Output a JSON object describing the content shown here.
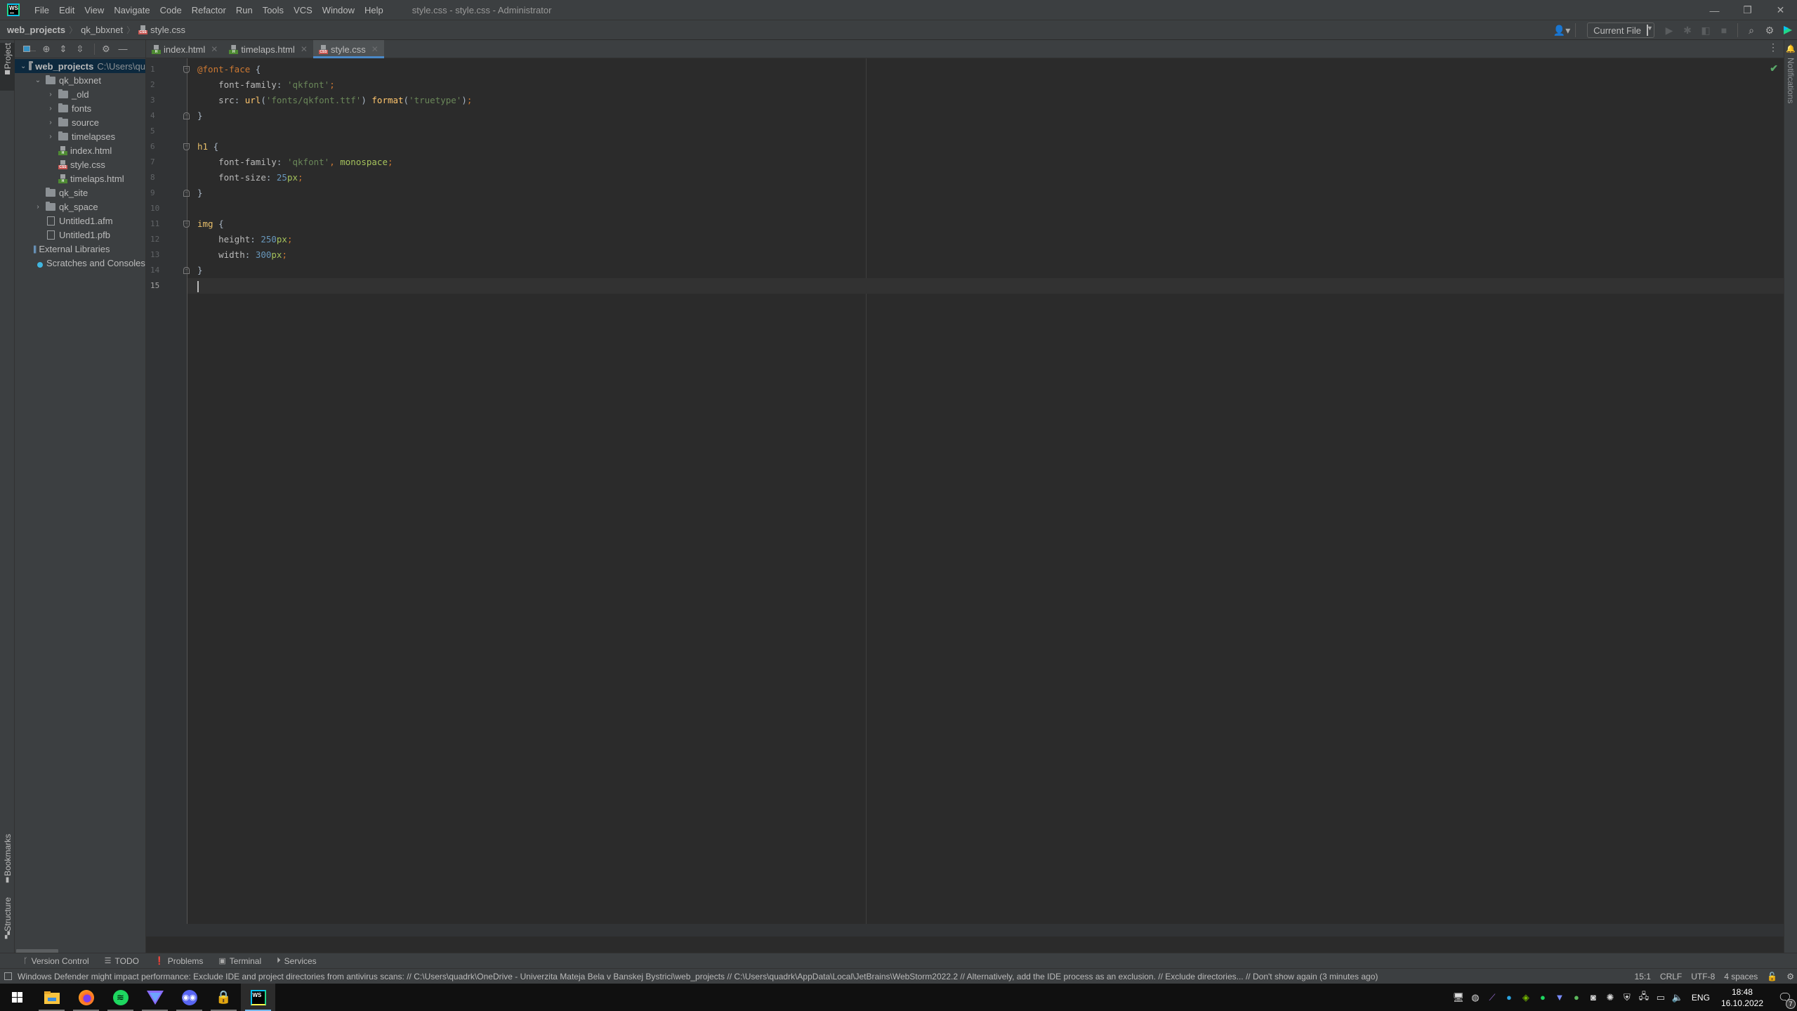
{
  "titlebar": {
    "app_logo": "WS",
    "menu": [
      "File",
      "Edit",
      "View",
      "Navigate",
      "Code",
      "Refactor",
      "Run",
      "Tools",
      "VCS",
      "Window",
      "Help"
    ],
    "window_title": "style.css - style.css - Administrator",
    "controls": {
      "minimize": "—",
      "restore": "❐",
      "close": "✕"
    }
  },
  "navbar": {
    "breadcrumbs": [
      "web_projects",
      "qk_bbxnet",
      "style.css"
    ],
    "run_config": "Current File",
    "icons": [
      "user-icon",
      "run-icon",
      "debug-icon",
      "coverage-icon",
      "stop-icon",
      "search-icon",
      "settings-icon",
      "toolbox-icon"
    ]
  },
  "left_strip": {
    "project_tab": "Project",
    "bookmarks_tab": "Bookmarks",
    "structure_tab": "Structure"
  },
  "right_strip": {
    "notifications_tab": "Notifications"
  },
  "project_panel": {
    "tree": [
      {
        "label": "web_projects",
        "path": "C:\\Users\\qu",
        "type": "folder",
        "expanded": true,
        "depth": 0,
        "selected": true
      },
      {
        "label": "qk_bbxnet",
        "type": "folder",
        "expanded": true,
        "depth": 1
      },
      {
        "label": "_old",
        "type": "folder",
        "expanded": false,
        "depth": 2
      },
      {
        "label": "fonts",
        "type": "folder",
        "expanded": false,
        "depth": 2
      },
      {
        "label": "source",
        "type": "folder",
        "expanded": false,
        "depth": 2
      },
      {
        "label": "timelapses",
        "type": "folder",
        "expanded": false,
        "depth": 2
      },
      {
        "label": "index.html",
        "type": "html",
        "depth": 2
      },
      {
        "label": "style.css",
        "type": "css",
        "depth": 2
      },
      {
        "label": "timelaps.html",
        "type": "html",
        "depth": 2
      },
      {
        "label": "qk_site",
        "type": "folder",
        "depth": 1
      },
      {
        "label": "qk_space",
        "type": "folder",
        "expanded": false,
        "depth": 1
      },
      {
        "label": "Untitled1.afm",
        "type": "file",
        "depth": 1
      },
      {
        "label": "Untitled1.pfb",
        "type": "file",
        "depth": 1
      },
      {
        "label": "External Libraries",
        "type": "libraries",
        "depth": 0
      },
      {
        "label": "Scratches and Consoles",
        "type": "scratches",
        "depth": 0
      }
    ]
  },
  "tabs": [
    {
      "label": "index.html",
      "type": "html",
      "active": false
    },
    {
      "label": "timelaps.html",
      "type": "html",
      "active": false
    },
    {
      "label": "style.css",
      "type": "css",
      "active": true
    }
  ],
  "editor": {
    "line_numbers": [
      "1",
      "2",
      "3",
      "4",
      "5",
      "6",
      "7",
      "8",
      "9",
      "10",
      "11",
      "12",
      "13",
      "14",
      "15"
    ],
    "current_line": 15,
    "lines": [
      "@font-face {",
      "    font-family: 'qkfont';",
      "    src: url('fonts/qkfont.ttf') format('truetype');",
      "}",
      "",
      "h1 {",
      "    font-family: 'qkfont', monospace;",
      "    font-size: 25px;",
      "}",
      "",
      "img {",
      "    height: 250px;",
      "    width: 300px;",
      "}",
      ""
    ],
    "tokens": {
      "l1_at": "@font-face",
      "l1_brace": " {",
      "l2_prop": "font-family",
      "l2_colon": ": ",
      "l2_str": "'qkfont'",
      "l2_semi": ";",
      "l3_prop": "src",
      "l3_colon": ": ",
      "l3_fn1": "url",
      "l3_p1": "(",
      "l3_str1": "'fonts/qkfont.ttf'",
      "l3_p2": ") ",
      "l3_fn2": "format",
      "l3_p3": "(",
      "l3_str2": "'truetype'",
      "l3_p4": ")",
      "l3_semi": ";",
      "l4_brace": "}",
      "l6_sel": "h1",
      "l6_brace": " {",
      "l7_prop": "font-family",
      "l7_colon": ": ",
      "l7_str": "'qkfont'",
      "l7_comma": ", ",
      "l7_kw": "monospace",
      "l7_semi": ";",
      "l8_prop": "font-size",
      "l8_colon": ": ",
      "l8_num": "25",
      "l8_unit": "px",
      "l8_semi": ";",
      "l9_brace": "}",
      "l11_sel": "img",
      "l11_brace": " {",
      "l12_prop": "height",
      "l12_colon": ": ",
      "l12_num": "250",
      "l12_unit": "px",
      "l12_semi": ";",
      "l13_prop": "width",
      "l13_colon": ": ",
      "l13_num": "300",
      "l13_unit": "px",
      "l13_semi": ";",
      "l14_brace": "}"
    },
    "inspection_status": "✔"
  },
  "tool_windows": [
    {
      "label": "Version Control",
      "icon": "branch-icon"
    },
    {
      "label": "TODO",
      "icon": "list-icon"
    },
    {
      "label": "Problems",
      "icon": "problems-icon"
    },
    {
      "label": "Terminal",
      "icon": "terminal-icon"
    },
    {
      "label": "Services",
      "icon": "services-icon"
    }
  ],
  "statusbar": {
    "message": "Windows Defender might impact performance: Exclude IDE and project directories from antivirus scans: // C:\\Users\\quadrk\\OneDrive - Univerzita Mateja Bela v Banskej Bystrici\\web_projects // C:\\Users\\quadrk\\AppData\\Local\\JetBrains\\WebStorm2022.2 // Alternatively, add the IDE process as an exclusion. // Exclude directories... // Don't show again (3 minutes ago)",
    "caret_position": "15:1",
    "line_separator": "CRLF",
    "encoding": "UTF-8",
    "indent": "4 spaces"
  },
  "taskbar": {
    "apps": [
      "start",
      "file-explorer",
      "firefox",
      "spotify",
      "proton-vpn",
      "discord",
      "vpn-lock",
      "webstorm"
    ],
    "tray_icons": [
      "network-transfer",
      "steam",
      "feather",
      "telegram",
      "nvidia",
      "spotify-tray",
      "vpn-tray",
      "updater",
      "discord-tray",
      "steelseries",
      "security-warning",
      "network",
      "power",
      "volume"
    ],
    "language": "ENG",
    "time": "18:48",
    "date": "16.10.2022",
    "notification_count": "7"
  }
}
